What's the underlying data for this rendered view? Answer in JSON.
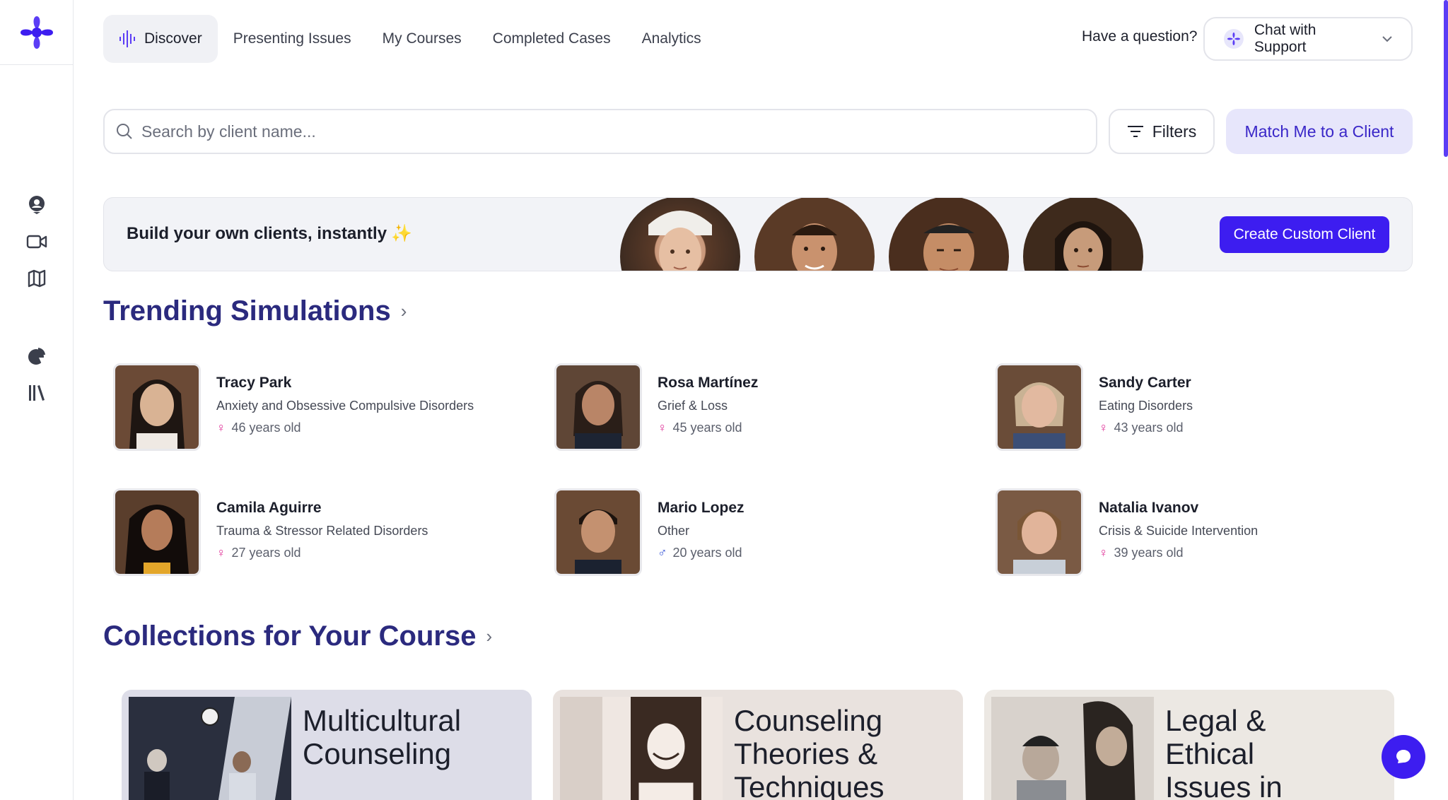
{
  "nav": {
    "tabs": [
      {
        "label": "Discover",
        "active": true
      },
      {
        "label": "Presenting Issues"
      },
      {
        "label": "My Courses"
      },
      {
        "label": "Completed Cases"
      },
      {
        "label": "Analytics"
      }
    ],
    "question": "Have a question?",
    "support_label": "Chat with Support"
  },
  "sidebar": {
    "icons": [
      "user-pin-icon",
      "video-icon",
      "map-icon",
      "chart-pie-icon",
      "library-icon"
    ]
  },
  "search": {
    "placeholder": "Search by client name...",
    "filters_label": "Filters",
    "match_label": "Match Me to a Client"
  },
  "banner": {
    "title": "Build your own clients, instantly",
    "sparkle": "✨",
    "create_label": "Create Custom Client"
  },
  "trending": {
    "title": "Trending Simulations",
    "clients": [
      {
        "name": "Tracy Park",
        "category": "Anxiety and Obsessive Compulsive Disorders",
        "age": "46 years old",
        "gender": "female"
      },
      {
        "name": "Rosa Martínez",
        "category": "Grief & Loss",
        "age": "45 years old",
        "gender": "female"
      },
      {
        "name": "Sandy Carter",
        "category": "Eating Disorders",
        "age": "43 years old",
        "gender": "female"
      },
      {
        "name": "Camila Aguirre",
        "category": "Trauma & Stressor Related Disorders",
        "age": "27 years old",
        "gender": "female"
      },
      {
        "name": "Mario Lopez",
        "category": "Other",
        "age": "20 years old",
        "gender": "male"
      },
      {
        "name": "Natalia Ivanov",
        "category": "Crisis & Suicide Intervention",
        "age": "39 years old",
        "gender": "female"
      }
    ]
  },
  "collections": {
    "title": "Collections for Your Course",
    "items": [
      {
        "title_line1": "Multicultural",
        "title_line2": "Counseling",
        "title_line3": ""
      },
      {
        "title_line1": "Counseling",
        "title_line2": "Theories &",
        "title_line3": "Techniques"
      },
      {
        "title_line1": "Legal &",
        "title_line2": "Ethical",
        "title_line3": "Issues in"
      }
    ]
  },
  "colors": {
    "brand": "#3d1df0",
    "heading": "#2b2a7e",
    "match_bg": "#e7e6fb",
    "female": "#e0369a",
    "male": "#3b58d6"
  }
}
